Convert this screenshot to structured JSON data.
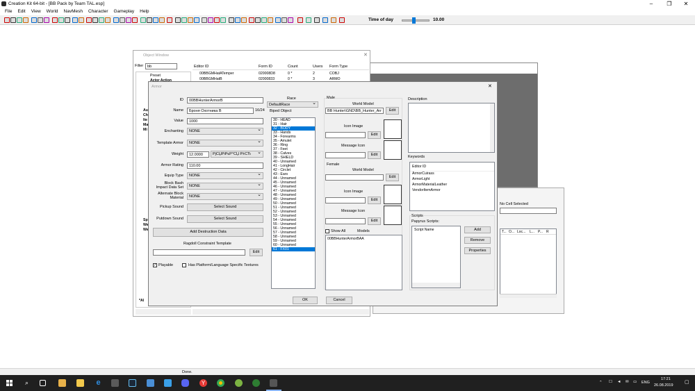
{
  "window": {
    "title": "Creation Kit 64-bit - [BB Pack by Team TAL.esp]",
    "min": "–",
    "max": "❐",
    "close": "✕"
  },
  "menu": [
    "File",
    "Edit",
    "View",
    "World",
    "NavMesh",
    "Character",
    "Gameplay",
    "Help"
  ],
  "toolbar": {
    "time_label": "Time of day",
    "time_value": "10.00",
    "time_fraction": 0.42
  },
  "object_window": {
    "title": "Object Window",
    "filter_label": "Filter",
    "filter_value": "bb",
    "tree": [
      "Preset",
      "Actor Action",
      "Au",
      "Ch",
      "Ite",
      "Ma",
      "Mi",
      "Sp",
      "We",
      "We",
      "*Al"
    ],
    "columns": [
      "Editor ID",
      "Form ID",
      "Count",
      "Users",
      "Form Type"
    ],
    "rows": [
      {
        "id": "00BBGMHatATemper",
        "form": "020008D8",
        "count": "0 *",
        "users": "2",
        "type": "COBJ"
      },
      {
        "id": "00BBGMHatB",
        "form": "02000833",
        "count": "0 *",
        "users": "3",
        "type": "ARMO"
      }
    ]
  },
  "cell_view": {
    "no_cell": "No Cell Selected",
    "columns": [
      "T...",
      "O...",
      "Loc...",
      "L...",
      "P...",
      "R"
    ]
  },
  "armor": {
    "title": "Armor",
    "id_label": "ID",
    "id_value": "00BBHunterArmorB",
    "name_label": "Name",
    "name_value": "Броня Охотника B",
    "name_count": "16/24",
    "value_label": "Value",
    "value_value": "1000",
    "enchanting_label": "Enchanting",
    "enchanting_value": "NONE",
    "template_label": "Template Armor",
    "template_value": "NONE",
    "weight_label": "Weight",
    "weight_value": "12.0000",
    "weight_type": "РјСЏРіРєР°СЏ Р±СЂ",
    "rating_label": "Armor Rating",
    "rating_value": "110.00",
    "equip_label": "Equip Type",
    "equip_value": "NONE",
    "blockbash_label1": "Block Bash",
    "blockbash_label2": "Impact Data Set",
    "blockbash_value": "NONE",
    "altblock_label1": "Alternate Block",
    "altblock_label2": "Material",
    "altblock_value": "NONE",
    "pickup_label": "Pickup Sound",
    "pickup_btn": "Select Sound",
    "putdown_label": "Putdown Sound",
    "putdown_btn": "Select Sound",
    "destruction_btn": "Add Destruction Data",
    "ragdoll_label": "Ragdoll Constraint Template",
    "ragdoll_edit": "Edit",
    "playable_label": "Playable",
    "platform_label": "Has Platform/Language Specific Textures",
    "race_label": "Race",
    "race_value": "DefaultRace",
    "biped_label": "Biped Object",
    "biped": [
      "30 - HEAD",
      "31 - Hair",
      "32 - BODY",
      "33 - Hands",
      "34 - Forearms",
      "35 - Amulet",
      "36 - Ring",
      "37 - Feet",
      "38 - Calves",
      "39 - SHIELD",
      "40 - Unnamed",
      "41 - LongHair",
      "42 - Circlet",
      "43 - Ears",
      "44 - Unnamed",
      "45 - Unnamed",
      "46 - Unnamed",
      "47 - Unnamed",
      "48 - Unnamed",
      "49 - Unnamed",
      "50 - Unnamed",
      "51 - Unnamed",
      "52 - Unnamed",
      "53 - Unnamed",
      "54 - Unnamed",
      "55 - Unnamed",
      "56 - Unnamed",
      "57 - Unnamed",
      "58 - Unnamed",
      "59 - Unnamed",
      "60 - Unnamed",
      "61 - FX01"
    ],
    "biped_selected": [
      2,
      31
    ],
    "male_label": "Male",
    "male_world_label": "World Model",
    "male_world_value": "BB Hunter\\GND\\BB_Hunter_Arr",
    "female_label": "Female",
    "female_world_label": "World Model",
    "icon_image_label": "Icon Image",
    "message_icon_label": "Message Icon",
    "edit_label": "Edit",
    "show_all_label": "Show All",
    "models_label": "Models",
    "models_item": "00BBHunterArmorBAA",
    "description_label": "Description",
    "keywords_label": "Keywords",
    "keywords_header": "Editor ID",
    "keywords": [
      "ArmorCuirass",
      "ArmorLight",
      "ArmorMaterialLeather",
      "VendorItemArmor"
    ],
    "scripts_label": "Scripts",
    "papyrus_label": "Papyrus Scripts:",
    "script_name_header": "Script Name",
    "add_btn": "Add",
    "remove_btn": "Remove",
    "properties_btn": "Properties",
    "ok_btn": "OK",
    "cancel_btn": "Cancel"
  },
  "status": {
    "text": "Done."
  },
  "taskbar": {
    "clock_time": "17:21",
    "clock_date": "26.08.2019",
    "lang": "ENG"
  }
}
